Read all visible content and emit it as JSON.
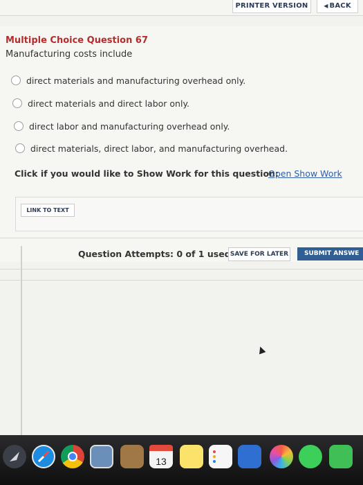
{
  "toolbar": {
    "printer_label": "PRINTER VERSION",
    "back_label": "BACK"
  },
  "question": {
    "title": "Multiple Choice Question 67",
    "prompt": "Manufacturing costs include",
    "options": [
      "direct materials and manufacturing overhead only.",
      "direct materials and direct labor only.",
      "direct labor and manufacturing overhead only.",
      "direct materials, direct labor, and manufacturing overhead."
    ],
    "show_work_text": "Click if you would like to Show Work for this question:",
    "show_work_link": "Open Show Work",
    "link_to_text": "LINK TO TEXT"
  },
  "footer": {
    "attempts": "Question Attempts: 0 of 1 used",
    "save_label": "SAVE FOR LATER",
    "submit_label": "SUBMIT ANSWE"
  },
  "dock": {
    "calendar_day": "13",
    "icons": [
      "launchpad-icon",
      "safari-icon",
      "chrome-icon",
      "preview-icon",
      "notebook-icon",
      "calendar-icon",
      "notes-icon",
      "reminders-icon",
      "keynote-icon",
      "photos-icon",
      "messages-icon",
      "facetime-icon"
    ]
  },
  "colors": {
    "title_red": "#b32d2d",
    "link_blue": "#2f5fa8",
    "submit_blue": "#2f5f93"
  }
}
